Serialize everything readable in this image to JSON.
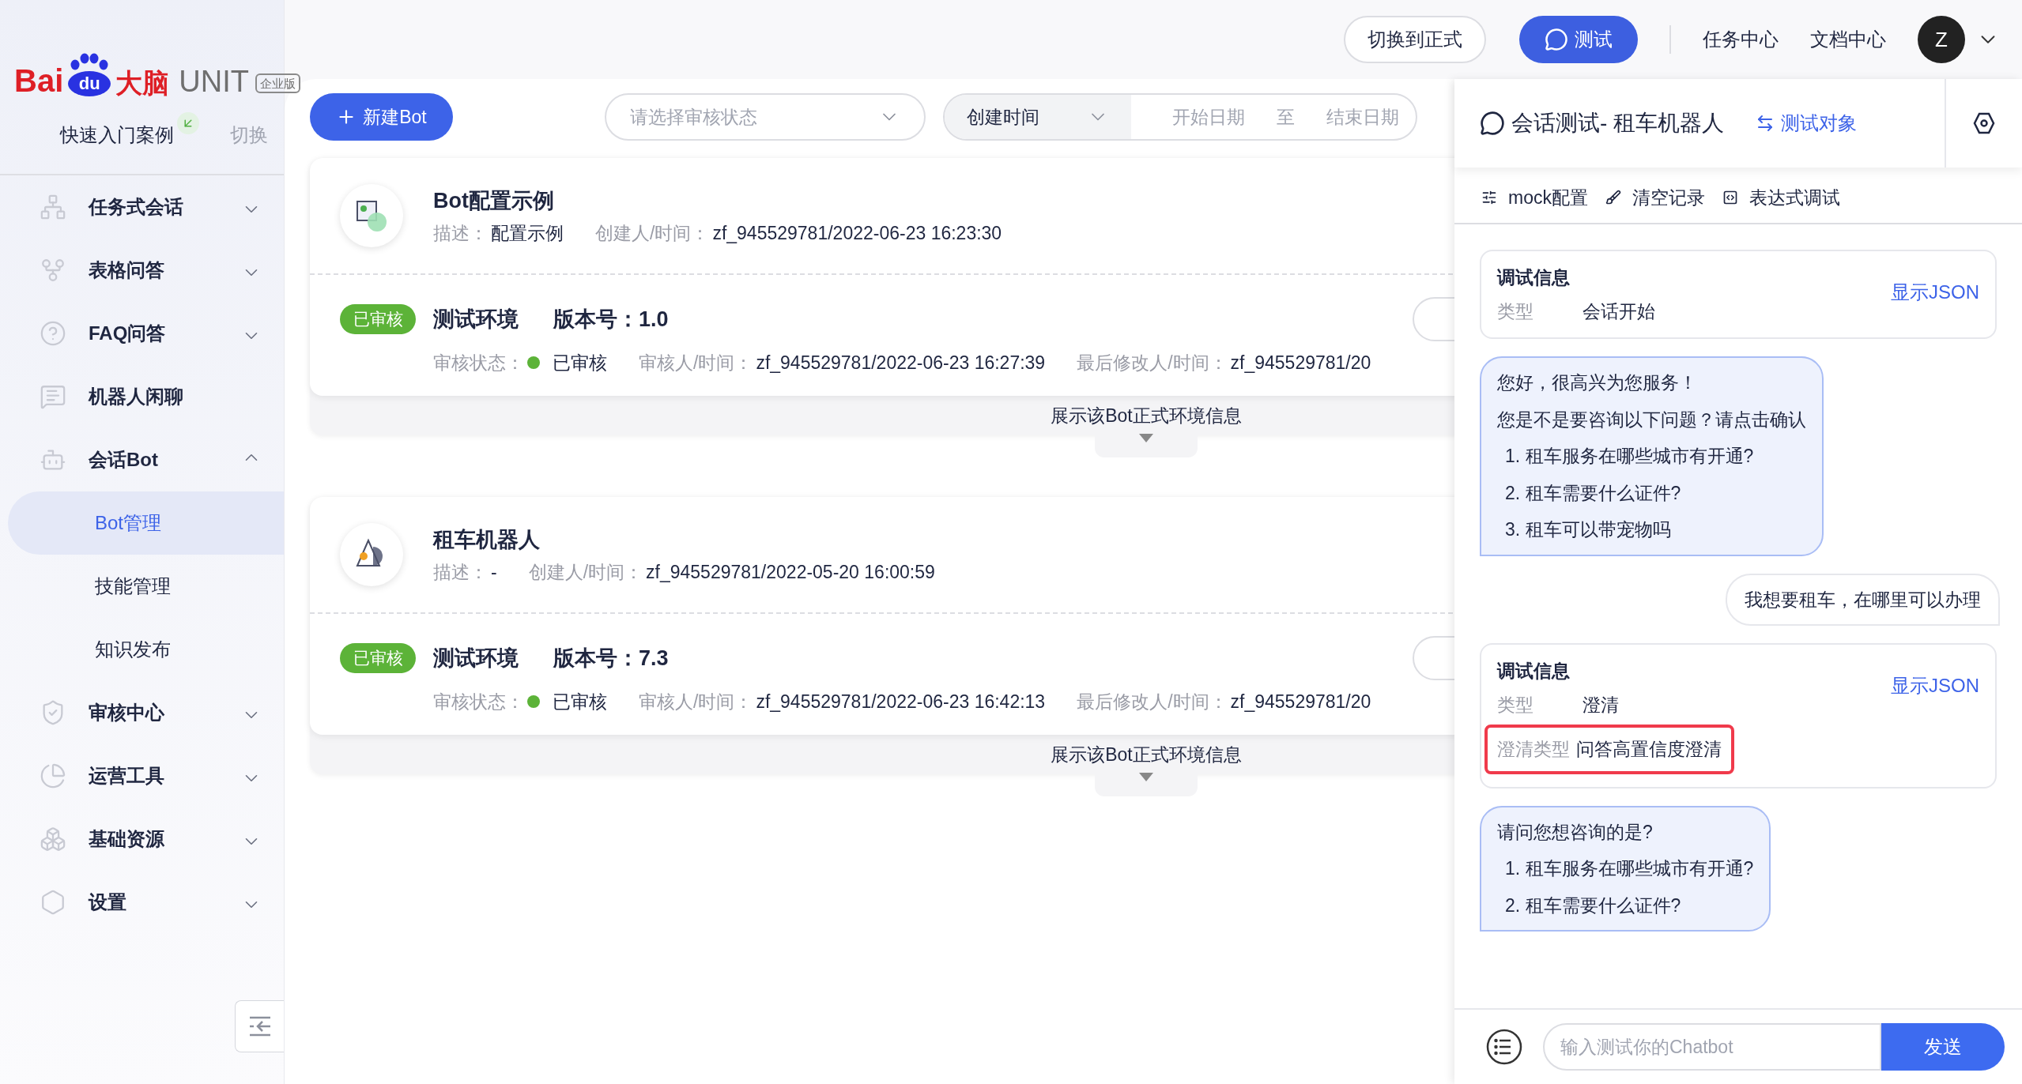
{
  "logo": {
    "brand": "Bai",
    "paw": "du",
    "brand_cn": "大脑",
    "product": "UNIT",
    "edition": "企业版"
  },
  "sidebar": {
    "quick_start": "快速入门案例",
    "switch": "切换",
    "items": [
      {
        "label": "任务式会话",
        "kind": "group",
        "expanded": false
      },
      {
        "label": "表格问答",
        "kind": "group",
        "expanded": false
      },
      {
        "label": "FAQ问答",
        "kind": "group",
        "expanded": false
      },
      {
        "label": "机器人闲聊",
        "kind": "link"
      },
      {
        "label": "会话Bot",
        "kind": "group",
        "expanded": true,
        "children": [
          {
            "label": "Bot管理",
            "selected": true
          },
          {
            "label": "技能管理",
            "selected": false
          },
          {
            "label": "知识发布",
            "selected": false
          }
        ]
      },
      {
        "label": "审核中心",
        "kind": "group",
        "expanded": false
      },
      {
        "label": "运营工具",
        "kind": "group",
        "expanded": false
      },
      {
        "label": "基础资源",
        "kind": "group",
        "expanded": false
      },
      {
        "label": "设置",
        "kind": "group",
        "expanded": false
      }
    ]
  },
  "topbar": {
    "buttons": [
      {
        "label": "切换到正式",
        "kind": "outline"
      },
      {
        "label": "测试",
        "kind": "primary"
      }
    ],
    "links": [
      "任务中心",
      "文档中心"
    ],
    "avatar": "Z"
  },
  "filters": {
    "new_button": "新建Bot",
    "status_select": {
      "placeholder": "请选择审核状态"
    },
    "time_select": "创建时间",
    "date_range": {
      "start_placeholder": "开始日期",
      "separator": "至",
      "end_placeholder": "结束日期"
    }
  },
  "bots": [
    {
      "name": "Bot配置示例",
      "desc_label": "描述：",
      "desc": "配置示例",
      "creator_label": "创建人/时间：",
      "creator": "zf_945529781/2022-06-23 16:23:30",
      "env": {
        "badge": "已审核",
        "name": "测试环境",
        "version_label": "版本号：",
        "version": "1.0",
        "status_label": "审核状态：",
        "status": "已审核",
        "reviewer_label": "审核人/时间：",
        "reviewer": "zf_945529781/2022-06-23 16:27:39",
        "modifier_label": "最后修改人/时间：",
        "modifier": "zf_945529781/20"
      },
      "expand_label": "展示该Bot正式环境信息"
    },
    {
      "name": "租车机器人",
      "desc_label": "描述：",
      "desc": "-",
      "creator_label": "创建人/时间：",
      "creator": "zf_945529781/2022-05-20 16:00:59",
      "env": {
        "badge": "已审核",
        "name": "测试环境",
        "version_label": "版本号：",
        "version": "7.3",
        "status_label": "审核状态：",
        "status": "已审核",
        "reviewer_label": "审核人/时间：",
        "reviewer": "zf_945529781/2022-06-23 16:42:13",
        "modifier_label": "最后修改人/时间：",
        "modifier": "zf_945529781/20"
      },
      "expand_label": "展示该Bot正式环境信息"
    }
  ],
  "chat": {
    "title": "会话测试- 租车机器人",
    "target_link": "测试对象",
    "tools": [
      "mock配置",
      "清空记录",
      "表达式调试"
    ],
    "messages": [
      {
        "kind": "debug",
        "title": "调试信息",
        "json_link": "显示JSON",
        "fields": [
          {
            "label": "类型",
            "value": "会话开始",
            "highlighted": false
          }
        ]
      },
      {
        "kind": "bot",
        "lines": [
          "您好，很高兴为您服务！",
          "您是不是要咨询以下问题？请点击确认"
        ],
        "options": [
          "1. 租车服务在哪些城市有开通?",
          "2. 租车需要什么证件?",
          "3. 租车可以带宠物吗"
        ]
      },
      {
        "kind": "user",
        "lines": [
          "我想要租车，在哪里可以办理"
        ]
      },
      {
        "kind": "debug",
        "title": "调试信息",
        "json_link": "显示JSON",
        "fields": [
          {
            "label": "类型",
            "value": "澄清",
            "highlighted": false
          },
          {
            "label": "澄清类型",
            "value": "问答高置信度澄清",
            "highlighted": true
          }
        ]
      },
      {
        "kind": "bot",
        "lines": [
          "请问您想咨询的是?"
        ],
        "options": [
          "1. 租车服务在哪些城市有开通?",
          "2. 租车需要什么证件?"
        ]
      }
    ],
    "input": {
      "placeholder": "输入测试你的Chatbot"
    },
    "send": "发送"
  }
}
